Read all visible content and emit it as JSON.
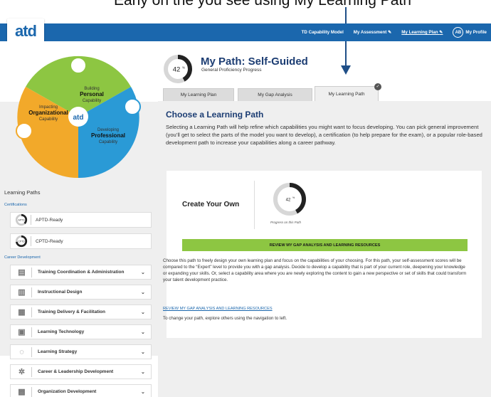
{
  "caption": {
    "text": "Early on the you see using My Learning Path"
  },
  "brand": {
    "logo_text": "atd",
    "primary": "#1b67ad",
    "dark_blue": "#1c3d73",
    "green": "#8dc642",
    "orange": "#f2a92a",
    "light_blue": "#2a9ad6"
  },
  "nav": {
    "items": [
      "TD Capability Model",
      "My Assessment",
      "My Learning Plan",
      "My Profile"
    ],
    "assessment_icon": "edit-icon",
    "plan_icon": "edit-icon",
    "avatar": "AB"
  },
  "diagram": {
    "personal": {
      "line1": "Building",
      "line2": "Personal",
      "line3": "Capability"
    },
    "organizational": {
      "line1": "Impacting",
      "line2": "Organizational",
      "line3": "Capability"
    },
    "professional": {
      "line1": "Developing",
      "line2": "Professional",
      "line3": "Capability"
    },
    "center": "atd"
  },
  "path": {
    "percent": "42",
    "percent_sign": "%",
    "progress_fraction": 0.42,
    "title": "My Path: Self-Guided",
    "subtitle": "General Proficiency Progress"
  },
  "tabs": [
    "My Learning Plan",
    "My Gap Analysis",
    "My Learning Path"
  ],
  "left": {
    "title": "Learning Paths",
    "certifications_label": "Certifications",
    "certs": [
      {
        "label": "APTD-Ready",
        "badge": "APTD"
      },
      {
        "label": "CPTD-Ready",
        "badge": "CPTD"
      }
    ],
    "career_label": "Career Development",
    "careers": [
      {
        "label": "Training Coordination & Administration",
        "icon": "clipboard-icon"
      },
      {
        "label": "Instructional Design",
        "icon": "building-icon"
      },
      {
        "label": "Training Delivery & Facilitation",
        "icon": "presentation-icon"
      },
      {
        "label": "Learning Technology",
        "icon": "laptop-icon"
      },
      {
        "label": "Learning Strategy",
        "icon": "lightbulb-icon"
      },
      {
        "label": "Career & Leadership Development",
        "icon": "gear-icon"
      },
      {
        "label": "Organization Development",
        "icon": "org-icon"
      }
    ]
  },
  "main": {
    "title": "Choose a Learning Path",
    "description": "Selecting a Learning Path will help refine which capabilities you might want to focus developing. You can pick general improvement (you’ll get to select the parts of the model you want to develop), a certification (to help prepare for the exam), or a popular role-based development path to increase your capabilities along a career pathway.",
    "card": {
      "title": "Create Your Own",
      "percent": "42",
      "percent_sign": "%",
      "progress_fraction": 0.42,
      "progress_label": "Progress on this Path",
      "button": "REVIEW MY GAP ANALYSIS AND LEARNING RESOURCES",
      "body": "Choose this path to freely design your own learning plan and focus on the capabilities of your choosing. For this path, your self-assessment scores will be compared to the “Expert” level to provide you with a gap analysis. Decide to develop a capability that is part of your current role, deepening your knowledge or expanding your skills. Or, select a capability area where you are newly exploring the content to gain a new perspective or set of skills that could transform your talent development practice.",
      "link": "REVIEW MY GAP ANALYSIS AND LEARNING RESOURCES",
      "note": "To change your path, explore others using the navigation to left."
    }
  }
}
